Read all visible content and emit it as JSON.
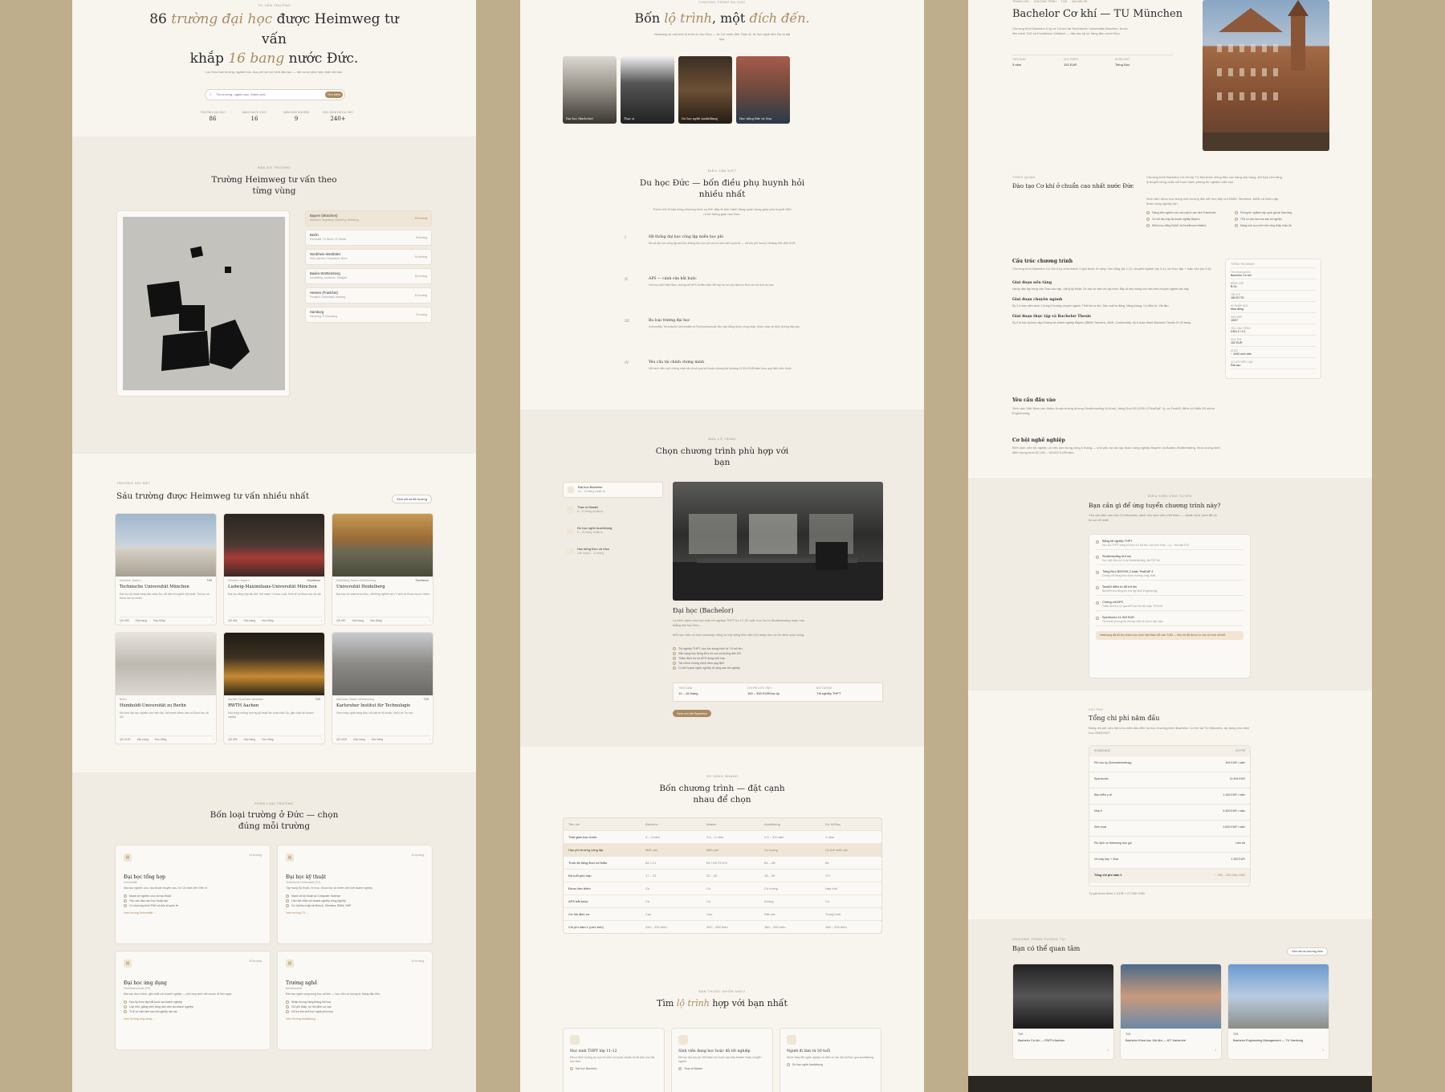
{
  "colors": {
    "bg": "#bfae8c",
    "panel": "#f8f5ef",
    "accent": "#a98b5e",
    "dark": "#2b2b2b"
  },
  "p1": {
    "hero": {
      "eyebrow": "TƯ VẤN TRƯỜNG",
      "title_a": "86",
      "title_b": "trường đại học",
      "title_c": "được Heimweg tư vấn",
      "title_d": "khắp",
      "title_e": "16 bang",
      "title_f": "nước Đức.",
      "sub": "Lọc theo loại trường, ngành học, học phí và mô hình đào tạo — tìm ra nơi phù hợp nhất với bạn.",
      "search_placeholder": "Tên trường, ngành học, thành phố...",
      "search_btn": "Tìm kiếm",
      "stats": [
        {
          "label": "TRƯỜNG ĐẠI HỌC",
          "value": "86"
        },
        {
          "label": "BANG NƯỚC ĐỨC",
          "value": "16"
        },
        {
          "label": "NĂM KINH NGHIỆM",
          "value": "9"
        },
        {
          "label": "HỌC SINH ĐÃ DU HỌC",
          "value": "240+"
        }
      ]
    },
    "map": {
      "eyebrow": "BẢN ĐỒ TRƯỜNG",
      "title": "Trường Heimweg tư vấn theo từng vùng",
      "regions": [
        {
          "name": "Bayern (München)",
          "sub": "München, Augsburg, Nürnberg, Würzburg",
          "count": "18 trường"
        },
        {
          "name": "Berlin",
          "sub": "Humboldt, TU Berlin, FU Berlin",
          "count": "8 trường"
        },
        {
          "name": "Nordrhein-Westfalen",
          "sub": "Köln, Aachen, Düsseldorf, Bonn",
          "count": "14 trường"
        },
        {
          "name": "Baden-Württemberg",
          "sub": "Heidelberg, Karlsruhe, Stuttgart",
          "count": "16 trường"
        },
        {
          "name": "Hessen (Frankfurt)",
          "sub": "Frankfurt, Darmstadt, Marburg",
          "count": "10 trường"
        },
        {
          "name": "Hamburg",
          "sub": "Hamburg, TU Hamburg",
          "count": "5 trường"
        }
      ]
    },
    "top": {
      "eyebrow": "TRƯỜNG NỔI BẬT",
      "title": "Sáu trường được Heimweg tư vấn nhiều nhất",
      "btn": "Xem tất cả 86 trường",
      "schools": [
        {
          "loc": "München, Bayern",
          "tag": "TU9",
          "name": "Technische Universität München",
          "desc": "Đại học kỹ thuật hàng đầu châu Âu, nổi bật với ngành Kỹ thuật, Tin học và Khoa học tự nhiên.",
          "m1": "QS #28",
          "m2": "Xếp hạng",
          "m3": "Học bổng"
        },
        {
          "loc": "München, Bayern",
          "tag": "Excellence",
          "name": "Ludwig-Maximilians-Universität München",
          "desc": "Đại học tổng hợp lâu đời, thế mạnh Y khoa, Luật, Kinh tế và Khoa học xã hội.",
          "m1": "QS #54",
          "m2": "Xếp hạng",
          "m3": "Học bổng"
        },
        {
          "loc": "Heidelberg, Baden-Württemberg",
          "tag": "Excellence",
          "name": "Universität Heidelberg",
          "desc": "Đại học cổ nhất nước Đức, nổi tiếng nghiên cứu Y sinh và Khoa học tự nhiên.",
          "m1": "QS #87",
          "m2": "Xếp hạng",
          "m3": "Học bổng"
        },
        {
          "loc": "Berlin",
          "tag": "",
          "name": "Humboldt-Universität zu Berlin",
          "desc": "Mô hình đại học nghiên cứu hiện đại, thế mạnh Nhân văn và Khoa học xã hội.",
          "m1": "QS #126",
          "m2": "Xếp hạng",
          "m3": "Học bổng"
        },
        {
          "loc": "Aachen, Nordrhein-Westfalen",
          "tag": "TU9",
          "name": "RWTH Aachen",
          "desc": "Một trong những trường kỹ thuật lớn nhất châu Âu, gắn chặt với doanh nghiệp.",
          "m1": "QS #99",
          "m2": "Xếp hạng",
          "m3": "Học bổng"
        },
        {
          "loc": "Karlsruhe, Baden-Württemberg",
          "tag": "TU9",
          "name": "Karlsruher Institut für Technologie",
          "desc": "Viện công nghệ hàng đầu, nổi bật về Kỹ thuật, Vật lý và Tin học.",
          "m1": "QS #119",
          "m2": "Xếp hạng",
          "m3": "Học bổng"
        }
      ]
    },
    "types": {
      "eyebrow": "PHÂN LOẠI TRƯỜNG",
      "title": "Bốn loại trường ở Đức — chọn đúng mỗi trường",
      "items": [
        {
          "count": "24 trường",
          "name": "Đại học tổng hợp",
          "sub": "Universität",
          "desc": "Đào tạo nghiên cứu, học thuật chuyên sâu, từ Cử nhân đến Tiến sĩ.",
          "b": [
            "Mạnh về nghiên cứu và học thuật",
            "Yêu cầu đầu vào học thuật cao",
            "Có chương trình PhD và tiến sĩ quốc tế"
          ],
          "link": "Xem trường Universität →"
        },
        {
          "count": "22 trường",
          "name": "Đại học kỹ thuật",
          "sub": "Technische Universität (TU)",
          "desc": "Tập trung Kỹ thuật, Tin học, Khoa học tự nhiên, liên kết doanh nghiệp.",
          "b": [
            "Mạnh về kỹ thuật và Computer Science",
            "Liên kết chặt với doanh nghiệp công nghiệp",
            "Cơ hội thực tập tại Bosch, Siemens, BMW, SAP"
          ],
          "link": "Xem trường TU →"
        },
        {
          "count": "30 trường",
          "name": "Đại học ứng dụng",
          "sub": "Fachhochschule (FH)",
          "desc": "Đào tạo thực hành, gắn chặt với doanh nghiệp — phù hợp sinh viên muốn đi làm ngay.",
          "b": [
            "Học kỳ thực tập bắt buộc tại doanh nghiệp",
            "Lớp nhỏ, giảng viên từng làm việc tại doanh nghiệp",
            "Tỉ lệ có việc làm sau tốt nghiệp rất cao"
          ],
          "link": "Xem trường ứng dụng →"
        },
        {
          "count": "10 trường",
          "name": "Trường nghề",
          "sub": "Berufsschule",
          "desc": "Đào tạo nghề song song học và làm — học viên có lương từ tháng đầu tiên.",
          "b": [
            "Nhận lương hàng tháng khi học",
            "Chi phí thấp, cơ hội định cư cao",
            "Hỗ trợ tìm chỗ học nghề phù hợp"
          ],
          "link": "Xem trường Ausbildung →"
        }
      ]
    }
  },
  "p2": {
    "paths": {
      "eyebrow": "CHƯƠNG TRÌNH DU HỌC",
      "title_a": "Bốn",
      "title_b": "lộ trình",
      "title_c": ", một",
      "title_d": "đích đến.",
      "sub": "Heimweg tư vấn bốn lộ trình du học Đức — từ Cử nhân đến Thạc sĩ, từ học nghề đến Dự bị đại học.",
      "cards": [
        {
          "label": "Đại học (Bachelor)"
        },
        {
          "label": "Thạc sĩ"
        },
        {
          "label": "Du học nghề Ausbildung"
        },
        {
          "label": "Học tiếng Đức và Visa"
        }
      ]
    },
    "why": {
      "eyebrow": "ĐIỀU CẦN BIẾT",
      "title": "Du học Đức — bốn điều phụ huynh hỏi nhiều nhất",
      "sub": "Trước khi đi sâu từng chương trình cụ thể, đây là bốn hành động quan trọng giúp phụ huynh hiểu rõ hệ thống giáo dục Đức.",
      "items": [
        {
          "num": "I",
          "title": "Hệ thống đại học công lập miễn học phí",
          "desc": "Đa số đại học công lập tại Đức không thu học phí với cả sinh viên quốc tế — chỉ thu phí học kỳ khoảng 150–350 EUR."
        },
        {
          "num": "II",
          "title": "APS — cánh cửa bắt buộc",
          "desc": "Với học sinh Việt Nam, chứng chỉ APS là điều kiện để nộp hồ sơ vào đại học Đức và xin visa du học."
        },
        {
          "num": "III",
          "title": "Ba loại trường đại học",
          "desc": "Universität, Technische Universität và Fachhochschule đều cấp bằng được công nhận, khác nhau về định hướng đào tạo."
        },
        {
          "num": "IV",
          "title": "Yêu cầu tài chính chứng minh",
          "desc": "Mỗi sinh viên cần chứng minh tài chính qua tài khoản phong tỏa khoảng 11.904 EUR/năm theo quy định hiện hành."
        }
      ]
    },
    "choose": {
      "eyebrow": "BẠN LỘ TRÌNH",
      "title": "Chọn chương trình phù hợp với bạn",
      "tabs": [
        {
          "name": "Đại học Bachelor",
          "sub": "12 – 16 tháng chuẩn bị"
        },
        {
          "name": "Thạc sĩ Master",
          "sub": "8 – 12 tháng chuẩn bị"
        },
        {
          "name": "Du học nghề Ausbildung",
          "sub": "6 – 12 tháng chuẩn bị"
        },
        {
          "name": "Học tiếng Đức và Visa",
          "sub": "Linh hoạt 4 – 12 tháng"
        }
      ],
      "detail_title": "Đại học (Bachelor)",
      "detail_desc": "Lộ trình dành cho học sinh tốt nghiệp THPT từ 17–22 tuổi, học Dự bị Studienkolleg hoặc vào thẳng đại học Đức.",
      "detail_desc2": "Mỗi học viên có một roadmap riêng từ lớp tiếng Đức đến khi nhập học và ổn định cuộc sống.",
      "bullets": [
        "Tốt nghiệp THPT, học lực trung bình từ 7.0 trở lên",
        "Sẵn sàng học tiếng Đức từ con số không đến B2",
        "Thẩm định hồ sơ APS đúng thời hạn",
        "Tài chính chứng minh theo quy định",
        "Có kế hoạch nghề nghiệp rõ ràng sau tốt nghiệp"
      ],
      "meta": [
        {
          "label": "THỜI GIAN",
          "value": "12 – 16 tháng"
        },
        {
          "label": "CHI PHÍ ƯỚC TÍNH",
          "value": "150 – 350 EUR/học kỳ"
        },
        {
          "label": "ĐỐI TƯỢNG",
          "value": "Tốt nghiệp THPT"
        }
      ],
      "btn": "Xem chi tiết Bachelor"
    },
    "compare": {
      "eyebrow": "SO SÁNH NHANH",
      "title": "Bốn chương trình — đặt cạnh nhau để chọn",
      "headers": [
        "Tiêu chí",
        "Bachelor",
        "Master",
        "Ausbildung",
        "Dự bị/Visa"
      ],
      "rows": [
        [
          "Thời gian học chính",
          "3 – 4 năm",
          "1.5 – 2 năm",
          "2.5 – 3.5 năm",
          "1 năm"
        ],
        [
          "Học phí trường công lập",
          "Miễn phí",
          "Miễn phí",
          "Có lương",
          "Có thể miễn phí"
        ],
        [
          "Trình độ tiếng Đức tối thiểu",
          "B2 / C1",
          "B2 / IELTS 6.5",
          "B1 – B2",
          "B1"
        ],
        [
          "Độ tuổi phù hợp",
          "17 – 22",
          "22 – 30",
          "18 – 30",
          "17+"
        ],
        [
          "Được làm thêm",
          "Có",
          "Có",
          "Có lương",
          "Hạn chế"
        ],
        [
          "APS bắt buộc",
          "Có",
          "Có",
          "Không",
          "Có"
        ],
        [
          "Cơ hội định cư",
          "Cao",
          "Cao",
          "Rất cao",
          "Trung bình"
        ],
        [
          "Chi phí năm 1 (ước tính)",
          "290 – 320 triệu",
          "300 – 350 triệu",
          "180 – 250 triệu",
          "180 – 220 triệu"
        ]
      ]
    },
    "find": {
      "eyebrow": "BẠN THUỘC NHÓM NÀO?",
      "title_a": "Tìm",
      "title_b": "lộ trình",
      "title_c": "hợp với bạn nhất",
      "cards": [
        {
          "title": "Học sinh THPT lớp 11-12",
          "desc": "Đã có định hướng du học từ sớm và muốn chuẩn bị bài bản cho đại học Đức.",
          "b": "Đại học Bachelor"
        },
        {
          "title": "Sinh viên đang học hoặc đã tốt nghiệp",
          "desc": "Đã học đại học tại Việt Nam và muốn học tiếp Master hoặc chuyển ngành.",
          "b": "Thạc sĩ Master"
        },
        {
          "title": "Người đi làm từ 30 tuổi",
          "desc": "Muốn thay đổi nghề nghiệp và định cư lâu dài tại Đức qua Ausbildung.",
          "b": "Du học nghề Ausbildung"
        }
      ]
    }
  },
  "p3": {
    "prog": {
      "crumb": [
        "TRANG CHỦ",
        "CHƯƠNG TRÌNH",
        "TUM",
        "BACHELOR"
      ],
      "title": "Bachelor Cơ khí — TU München",
      "desc": "Chương trình Bachelor 6 kỳ về Cơ khí tại Technische Universität München, thuộc liên minh TU9 và Excellence Initiative — đào tạo kỹ sư hàng đầu nước Đức.",
      "facts": [
        {
          "label": "THỜI GIAN",
          "value": "3 năm"
        },
        {
          "label": "HỌC PHÍ/KỲ",
          "value": "152 EUR"
        },
        {
          "label": "NGÔN NGỮ",
          "value": "Tiếng Đức"
        }
      ]
    },
    "overview": {
      "eyebrow": "TỔNG QUAN",
      "title": "Đào tạo Cơ khí ở chuẩn cao nhất nước Đức",
      "desc": "Chương trình Bachelor Cơ khí tại TU München đứng đầu các bảng xếp hạng, kết hợp nền tảng lý thuyết vững chắc với thực hành phòng thí nghiệm hiện đại.",
      "desc2": "Sinh viên được học trong môi trường liên kết trực tiếp với BMW, Siemens, MAN và nhiều tập đoàn công nghiệp lớn.",
      "bullets": [
        "Giảng viên nghiên cứu cao cấp từ các viện Fraunhofer",
        "Cơ hội thực tập tại doanh nghiệp Bayern",
        "Nhiều học bổng DAAD và Excellence Initiative",
        "Phòng thí nghiệm cấp quốc gia tại Garching",
        "Tỉ lệ có việc làm cao sau tốt nghiệp",
        "Mạng lưới cựu sinh viên rộng khắp châu Âu"
      ]
    },
    "structure": {
      "title": "Cấu trúc chương trình",
      "desc": "Chương trình Bachelor Cơ khí 6 kỳ chia thành 3 giai đoạn rõ ràng: nền tảng (kỳ 1-2), chuyên ngành (kỳ 3-4), và thực tập + luận văn (kỳ 5-6).",
      "phases": [
        {
          "t": "Giai đoạn nền tảng",
          "d": "Hai kỳ đầu tập trung vào Toán cao cấp, Vật lý kỹ thuật, Cơ học cơ bản và Lập trình. Đây là nền móng cho mọi môn chuyên ngành sau này."
        },
        {
          "t": "Giai đoạn chuyên ngành",
          "d": "Kỳ 3-4 sinh viên chọn 1 trong 5 hướng chuyên ngành: Thiết kế cơ khí, Sản xuất tự động, Năng lượng, Cơ điện tử, Vật liệu."
        },
        {
          "t": "Giai đoạn thực tập và Bachelor Thesis",
          "d": "Kỳ 5 là học kỳ thực tập 6 tháng tại doanh nghiệp Bayern (BMW, Siemens, MAN, Continental). Kỳ 6 hoàn thành Bachelor Thesis 20-40 trang."
        }
      ],
      "side": [
        {
          "l": "THÔNG TIN NHANH",
          "v": ""
        },
        {
          "l": "Tên chương trình",
          "v": "Bachelor Cơ khí"
        },
        {
          "l": "BẰNG CẤP",
          "v": "B.Sc."
        },
        {
          "l": "TÍN CHỈ",
          "v": "180 ECTS"
        },
        {
          "l": "KỲ NHẬP HỌC",
          "v": "Mùa đông"
        },
        {
          "l": "HẠN NỘP",
          "v": "15/07"
        },
        {
          "l": "YÊU CẦU TIẾNG",
          "v": "DSH-2 / C1"
        },
        {
          "l": "HỌC PHÍ",
          "v": "152 EUR"
        },
        {
          "l": "SĨ SỐ",
          "v": "~ 1000 sinh viên"
        },
        {
          "l": "CƠ HỘI VIỆC LÀM",
          "v": "Rất cao"
        }
      ],
      "req_title": "Yêu cầu đầu vào",
      "req_desc": "Sinh viên Việt Nam cần Abitur (hoặc tương đương Studienkolleg M-Kurs), tiếng Đức B2 (DSH-2/TestDaF 4), và TestAS điểm tối thiểu 85 nhóm Engineering.",
      "career_title": "Cơ hội nghề nghiệp",
      "career_desc": "96% sinh viên tốt nghiệp có việc làm trong vòng 6 tháng — chủ yếu tại các tập đoàn công nghiệp Bayern và Baden-Württemberg. Mức lương khởi điểm trung bình 52.000 – 65.000 EUR/năm."
    },
    "cond": {
      "eyebrow": "ĐIỀU KIỆN ỨNG TUYỂN",
      "title": "Bạn cần gì để ứng tuyển chương trình này?",
      "sub": "Yêu cầu đầu vào của TU München dành cho sinh viên Việt Nam — chuẩn bị từ sớm để có hồ sơ tốt nhất.",
      "items": [
        {
          "t": "Bằng tốt nghiệp THPT",
          "d": "Học lực THPT trung bình từ 8.0 trở lên, các môn Toán – Lý – Hóa đạt 8.5+."
        },
        {
          "t": "Studienkolleg M-Kurs",
          "d": "Học một năm dự bị tại Studienkolleg, đạt FSP tốt."
        },
        {
          "t": "Tiếng Đức B2/DSH-2 hoặc TestDaF 4",
          "d": "Chứng chỉ tiếng Đức được trường công nhận."
        },
        {
          "t": "TestAS điểm từ 85 trở lên",
          "d": "Bài kiểm tra năng lực học tập khối Engineering."
        },
        {
          "t": "Chứng chỉ APS",
          "d": "Thẩm định hồ sơ qua APS tại Hà Nội hoặc TP.HCM."
        },
        {
          "t": "Sperrkonto 11.904 EUR",
          "d": "Tài khoản phong tỏa chứng minh tài chính năm đầu."
        }
      ],
      "note": "Heimweg đã hỗ trợ nhiều học sinh Việt Nam đỗ vào TUM — liên hệ để được tư vấn lộ trình chi tiết."
    },
    "cost": {
      "eyebrow": "CHI PHÍ",
      "title": "Tổng chi phí năm đầu",
      "sub": "Bảng chi phí ước tính cho năm đầu tiên du học chương trình Bachelor Cơ khí tại TU München, áp dụng cho năm học 2026/2027.",
      "head": [
        "KHOẢN MỤC",
        "CHI PHÍ"
      ],
      "rows": [
        [
          "Phí học kỳ (Semesterbeitrag)",
          "304 EUR / năm"
        ],
        [
          "Sperrkonto",
          "11.904 EUR"
        ],
        [
          "Bảo hiểm y tế",
          "1.440 EUR / năm"
        ],
        [
          "Nhà ở",
          "5.400 EUR / năm"
        ],
        [
          "Sinh hoạt",
          "3.600 EUR / năm"
        ],
        [
          "Phí dịch vụ Heimweg trọn gói",
          "Liên hệ"
        ],
        [
          "Vé máy bay + Visa",
          "1.200 EUR"
        ]
      ],
      "total": [
        "Tổng chi phí năm 1",
        "~ 290 – 320 triệu VNĐ"
      ],
      "note": "Tỷ giá tham khảo 1 EUR ≈ 27.000 VNĐ."
    },
    "related": {
      "eyebrow": "CHƯƠNG TRÌNH TƯƠNG TỰ",
      "title": "Bạn có thể quan tâm",
      "btn": "Xem tất cả chương trình",
      "cards": [
        {
          "tag": "TU9",
          "name": "Bachelor Cơ khí — RWTH Aachen"
        },
        {
          "tag": "TU9",
          "name": "Bachelor Khoa học Vật liệu — KIT Karlsruhe"
        },
        {
          "tag": "TU9",
          "name": "Bachelor Engineering Management — TU Hamburg"
        }
      ]
    }
  }
}
